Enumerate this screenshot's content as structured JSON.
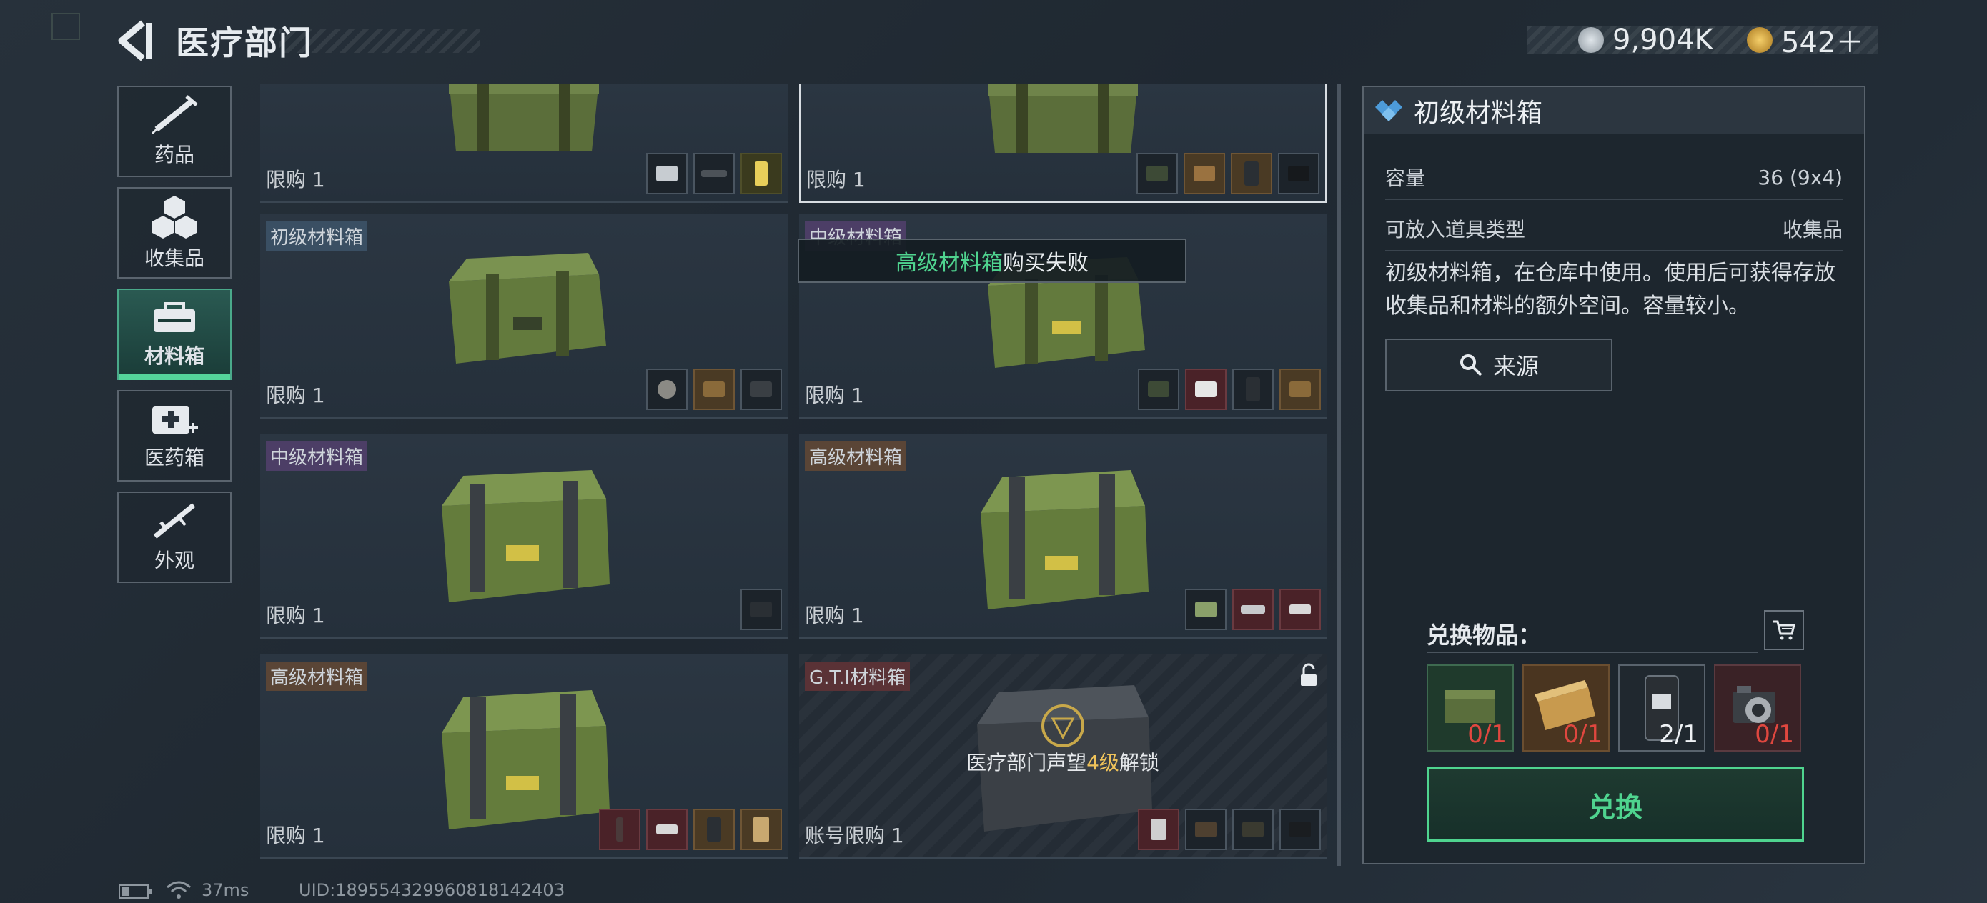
{
  "header": {
    "title": "医疗部门",
    "currency": [
      {
        "icon": "silver-coin-icon",
        "value": "9,904K"
      },
      {
        "icon": "gold-coin-icon",
        "value": "542＋"
      }
    ]
  },
  "sidebar": {
    "items": [
      {
        "label": "药品",
        "icon": "syringe-icon",
        "active": false
      },
      {
        "label": "收集品",
        "icon": "cubes-icon",
        "active": false
      },
      {
        "label": "材料箱",
        "icon": "tools-box-icon",
        "active": true
      },
      {
        "label": "医药箱",
        "icon": "medkit-icon",
        "active": false
      },
      {
        "label": "外观",
        "icon": "rifle-icon",
        "active": false
      }
    ]
  },
  "grid": {
    "cards": [
      {
        "tag": "",
        "limit": "限购 1",
        "minis": 3,
        "selected": false
      },
      {
        "tag": "",
        "limit": "限购 1",
        "minis": 4,
        "selected": true
      },
      {
        "tag": "初级材料箱",
        "limit": "限购 1",
        "minis": 3
      },
      {
        "tag": "中级材料箱",
        "limit": "限购 1",
        "minis": 4
      },
      {
        "tag": "中级材料箱",
        "limit": "限购 1",
        "minis": 1
      },
      {
        "tag": "高级材料箱",
        "limit": "限购 1",
        "minis": 3
      },
      {
        "tag": "高级材料箱",
        "limit": "限购 1",
        "minis": 4
      },
      {
        "tag": "G.T.I材料箱",
        "limit": "账号限购 1",
        "minis": 4,
        "locked": true
      }
    ],
    "locked_msg_pre": "医疗部门声望",
    "locked_msg_level": "4级",
    "locked_msg_post": "解锁"
  },
  "toast": {
    "item": "高级材料箱",
    "text": "购买失败"
  },
  "detail": {
    "title": "初级材料箱",
    "capacity_label": "容量",
    "capacity_value": "36 (9x4)",
    "type_label": "可放入道具类型",
    "type_value": "收集品",
    "description": "初级材料箱，在仓库中使用。使用后可获得存放收集品和材料的额外空间。容量较小。",
    "source_label": "来源",
    "exchange_title": "兑换物品：",
    "requirements": [
      {
        "name": "small-crate-item",
        "count": "0/1",
        "enough": false
      },
      {
        "name": "ammo-box-item",
        "count": "0/1",
        "enough": false
      },
      {
        "name": "device-item",
        "count": "2/1",
        "enough": true
      },
      {
        "name": "camera-item",
        "count": "0/1",
        "enough": false
      }
    ],
    "exchange_button": "兑换"
  },
  "status": {
    "ping": "37ms",
    "uid": "UID:18955432996081814240З"
  }
}
